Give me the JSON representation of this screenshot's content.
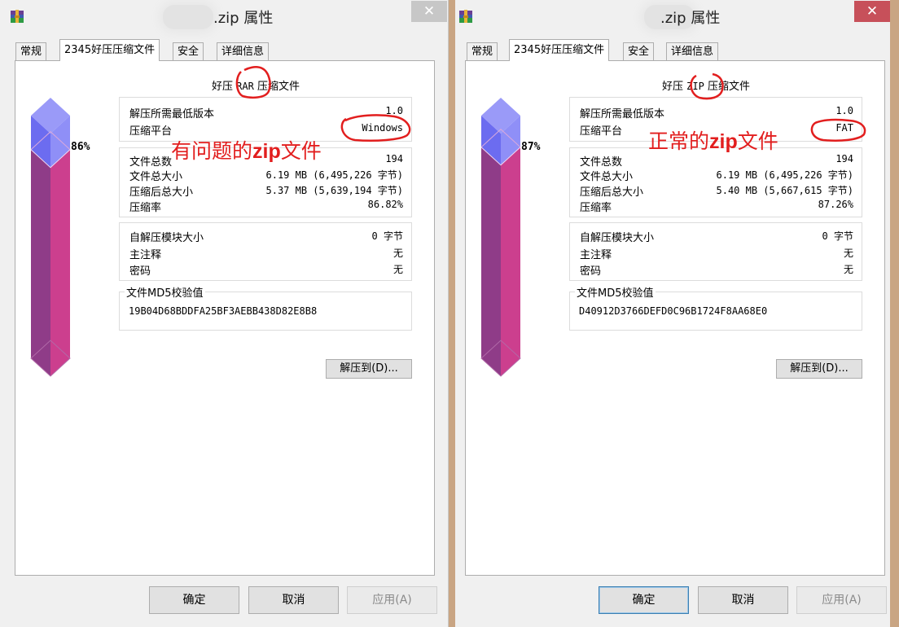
{
  "left": {
    "title_suffix": ".zip 属性",
    "close_symbol": "✕",
    "tabs": [
      "常规",
      "2345好压压缩文件",
      "安全",
      "详细信息"
    ],
    "active_tab": 1,
    "gauge_percent": "86%",
    "gauge_fill_fraction": 0.86,
    "type_prefix": "好压",
    "type_format": "RAR",
    "type_suffix": "压缩文件",
    "group1": [
      {
        "label": "解压所需最低版本",
        "value": "1.0"
      },
      {
        "label": "压缩平台",
        "value": "Windows"
      }
    ],
    "group2": [
      {
        "label": "文件总数",
        "value": "194"
      },
      {
        "label": "文件总大小",
        "value": "6.19 MB (6,495,226 字节)"
      },
      {
        "label": "压缩后总大小",
        "value": "5.37 MB (5,639,194 字节)"
      },
      {
        "label": "压缩率",
        "value": "86.82%"
      }
    ],
    "group3": [
      {
        "label": "自解压模块大小",
        "value": "0 字节"
      },
      {
        "label": "主注释",
        "value": "无"
      },
      {
        "label": "密码",
        "value": "无"
      }
    ],
    "md5_label": "文件MD5校验值",
    "md5_value": "19B04D68BDDFA25BF3AEBB438D82E8B8",
    "extract_button": "解压到(D)...",
    "annotation_pre": "有问题的",
    "annotation_bold": "zip",
    "annotation_post": "文件",
    "buttons": {
      "ok": "确定",
      "cancel": "取消",
      "apply": "应用(A)"
    }
  },
  "right": {
    "title_suffix": ".zip 属性",
    "close_symbol": "✕",
    "tabs": [
      "常规",
      "2345好压压缩文件",
      "安全",
      "详细信息"
    ],
    "active_tab": 1,
    "gauge_percent": "87%",
    "gauge_fill_fraction": 0.87,
    "type_prefix": "好压",
    "type_format": "ZIP",
    "type_suffix": "压缩文件",
    "group1": [
      {
        "label": "解压所需最低版本",
        "value": "1.0"
      },
      {
        "label": "压缩平台",
        "value": "FAT"
      }
    ],
    "group2": [
      {
        "label": "文件总数",
        "value": "194"
      },
      {
        "label": "文件总大小",
        "value": "6.19 MB (6,495,226 字节)"
      },
      {
        "label": "压缩后总大小",
        "value": "5.40 MB (5,667,615 字节)"
      },
      {
        "label": "压缩率",
        "value": "87.26%"
      }
    ],
    "group3": [
      {
        "label": "自解压模块大小",
        "value": "0 字节"
      },
      {
        "label": "主注释",
        "value": "无"
      },
      {
        "label": "密码",
        "value": "无"
      }
    ],
    "md5_label": "文件MD5校验值",
    "md5_value": "D40912D3766DEFD0C96B1724F8AA68E0",
    "extract_button": "解压到(D)...",
    "annotation_pre": "正常的",
    "annotation_bold": "zip",
    "annotation_post": "文件",
    "buttons": {
      "ok": "确定",
      "cancel": "取消",
      "apply": "应用(A)"
    }
  }
}
